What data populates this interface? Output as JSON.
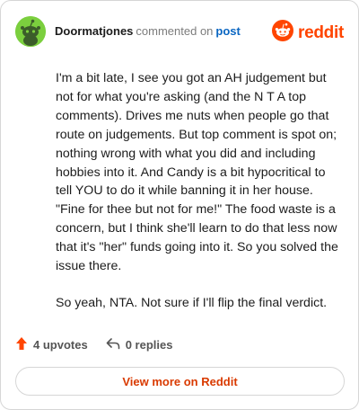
{
  "comment": {
    "author": "Doormatjones",
    "verb": "commented on",
    "link_text": "post",
    "paragraphs": [
      "I'm a bit late, I see you got an AH judgement but not for what you're asking (and the N T A top comments). Drives me nuts when people go that route on judgements. But top comment is spot on; nothing wrong with what you did and including hobbies into it. And Candy is a bit hypocritical to tell YOU to do it while banning it in her house. \"Fine for thee but not for me!\" The food waste is a concern, but I think she'll learn to do that less now that it's \"her\" funds going into it. So you solved the issue there.",
      "So yeah, NTA. Not sure if I'll flip the final verdict."
    ],
    "upvotes": "4 upvotes",
    "replies": "0 replies"
  },
  "brand": {
    "wordmark": "reddit",
    "icon": "reddit-logo-icon",
    "color": "#ff4500"
  },
  "avatar": {
    "icon": "snoo-avatar-icon",
    "color": "#7bcf3e"
  },
  "icons": {
    "upvote": "upvote-arrow-icon",
    "reply": "reply-arrow-icon"
  },
  "colors": {
    "upvote": "#ff4500",
    "link": "#0a66c2",
    "button_text": "#d93a00"
  },
  "view_button_label": "View more on Reddit"
}
